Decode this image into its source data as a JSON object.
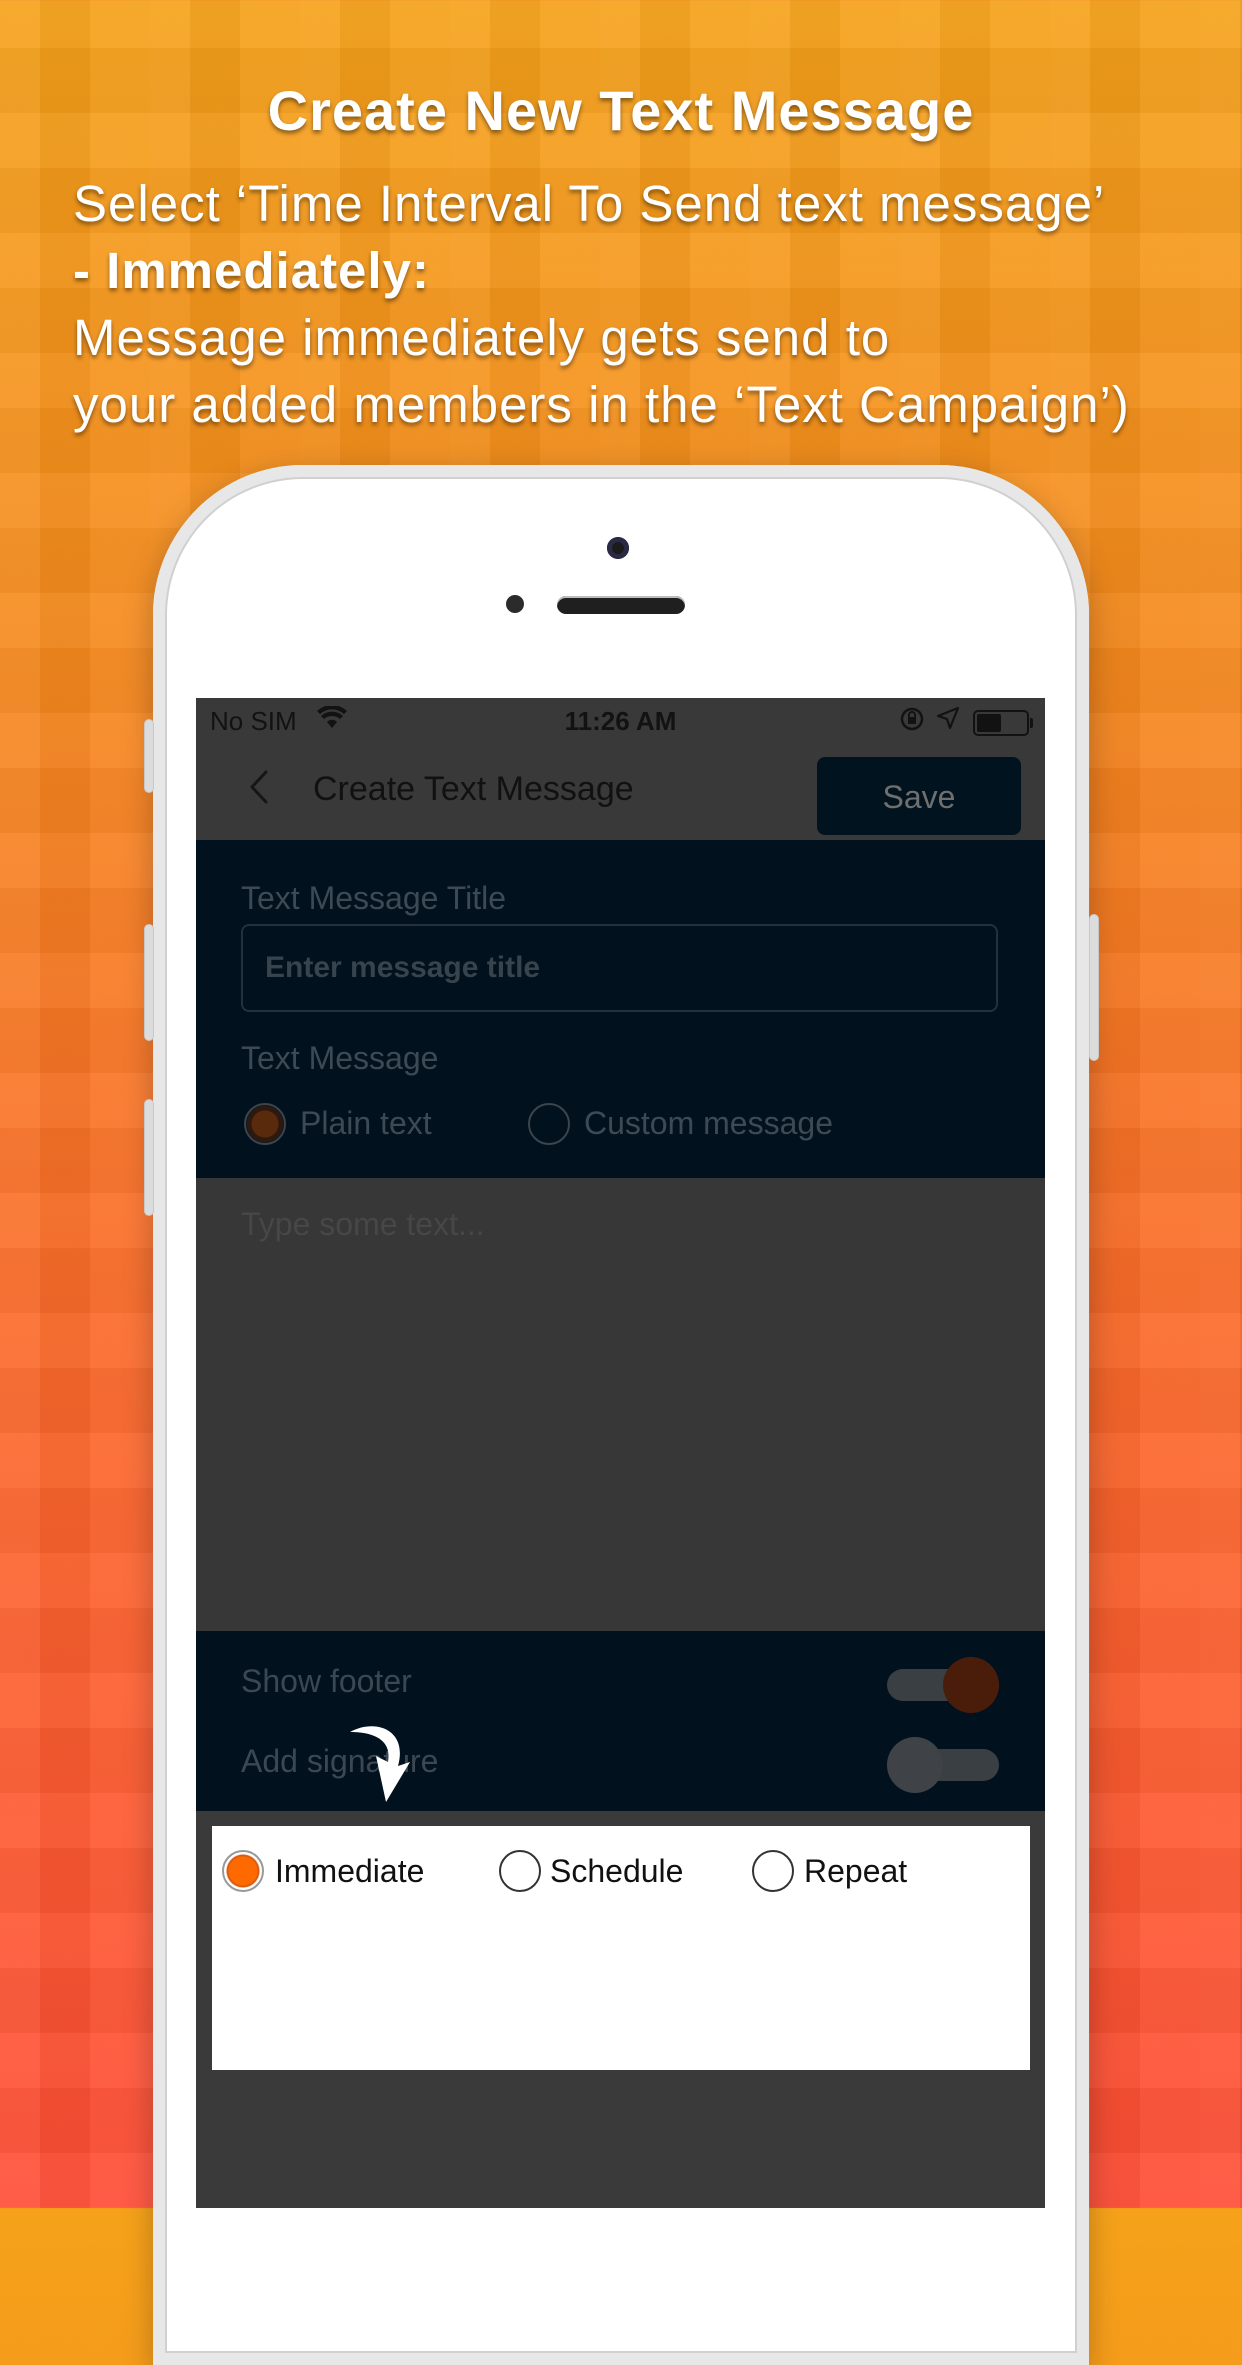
{
  "headline": "Create New Text Message",
  "description": {
    "line1": "Select ‘Time Interval To Send text message’",
    "line2": "- Immediately:",
    "line3": "Message immediately gets send to",
    "line4": "your added members in the ‘Text Campaign’)"
  },
  "statusbar": {
    "carrier": "No SIM",
    "time": "11:26 AM",
    "battery_level": 0.55
  },
  "navbar": {
    "back_icon": "chevron-left-icon",
    "title": "Create Text Message",
    "save_label": "Save"
  },
  "form": {
    "title_label": "Text Message Title",
    "title_placeholder": "Enter message title",
    "message_label": "Text Message",
    "message_types": [
      {
        "label": "Plain text",
        "selected": true
      },
      {
        "label": "Custom message",
        "selected": false
      }
    ],
    "text_placeholder": "Type some text..."
  },
  "toggles": {
    "show_footer": {
      "label": "Show footer",
      "on": true
    },
    "add_signature": {
      "label": "Add signature",
      "on": false
    }
  },
  "interval": {
    "options": [
      {
        "label": "Immediate",
        "selected": true
      },
      {
        "label": "Schedule",
        "selected": false
      },
      {
        "label": "Repeat",
        "selected": false
      }
    ]
  },
  "colors": {
    "accent": "#ff6a00",
    "navy": "#01111d"
  }
}
